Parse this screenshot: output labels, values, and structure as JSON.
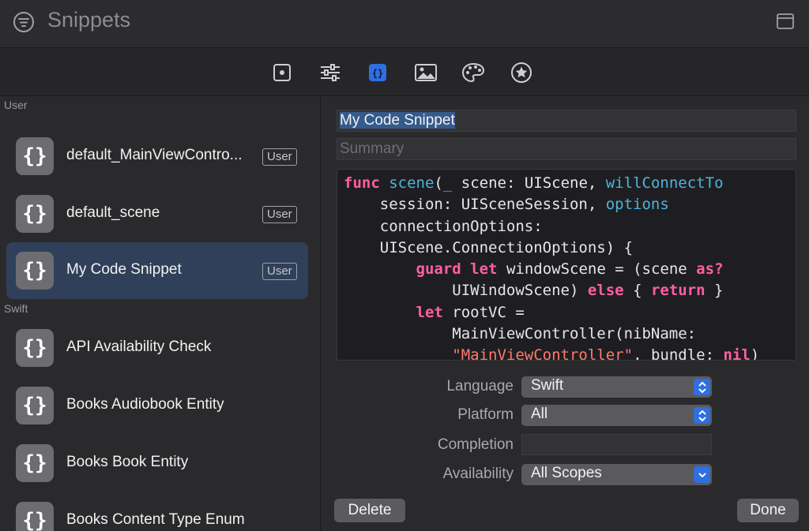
{
  "window": {
    "title": "Snippets"
  },
  "toolbar": {
    "items": [
      {
        "name": "file-inspector-icon"
      },
      {
        "name": "sliders-icon"
      },
      {
        "name": "code-snippet-icon",
        "selected": true
      },
      {
        "name": "media-icon"
      },
      {
        "name": "color-palette-icon"
      },
      {
        "name": "star-icon"
      }
    ]
  },
  "sidebar": {
    "sections": [
      {
        "label": "User"
      },
      {
        "label": "Swift"
      }
    ],
    "items": [
      {
        "icon": "{}",
        "name": "default_MainViewContro...",
        "badge": "User"
      },
      {
        "icon": "{}",
        "name": "default_scene",
        "badge": "User"
      },
      {
        "icon": "{}",
        "name": "My Code Snippet",
        "badge": "User",
        "selected": true
      },
      {
        "icon": "{}",
        "name": "API Availability Check",
        "badge": ""
      },
      {
        "icon": "{}",
        "name": "Books Audiobook Entity",
        "badge": ""
      },
      {
        "icon": "{}",
        "name": "Books Book Entity",
        "badge": ""
      },
      {
        "icon": "{}",
        "name": "Books Content Type Enum",
        "badge": ""
      }
    ]
  },
  "detail": {
    "title_value": "My Code Snippet",
    "summary_placeholder": "Summary",
    "code_lines": [
      "func scene(_ scene: UIScene, willConnectTo",
      "    session: UISceneSession, options",
      "    connectionOptions:",
      "    UIScene.ConnectionOptions) {",
      "        guard let windowScene = (scene as?",
      "            UIWindowScene) else { return }",
      "        let rootVC =",
      "            MainViewController(nibName:",
      "            \"MainViewController\", bundle: nil)"
    ],
    "form": {
      "language_label": "Language",
      "language_value": "Swift",
      "platform_label": "Platform",
      "platform_value": "All",
      "completion_label": "Completion",
      "completion_value": "",
      "availability_label": "Availability",
      "availability_value": "All Scopes"
    },
    "delete_label": "Delete",
    "done_label": "Done"
  },
  "colors": {
    "accent": "#2f6fe0",
    "selection": "#30405a",
    "keyword": "#ff5fa2",
    "identifier": "#4fb3d8",
    "string": "#ff7b6b"
  }
}
